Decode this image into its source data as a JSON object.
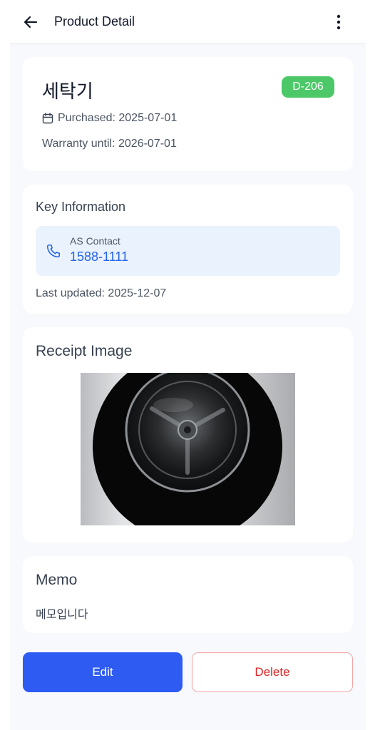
{
  "appbar": {
    "title": "Product Detail",
    "back_icon": "arrow-left-icon",
    "more_icon": "more-vertical-icon"
  },
  "product": {
    "name": "세탁기",
    "badge": "D-206",
    "badge_color": "#4cc869",
    "purchased": "Purchased: 2025-07-01",
    "purchased_icon": "calendar-icon",
    "warranty": "Warranty until: 2026-07-01"
  },
  "key_info": {
    "title": "Key Information",
    "contact_label": "AS Contact",
    "contact_number": "1588-1111",
    "contact_icon": "phone-icon",
    "last_updated": "Last updated: 2025-12-07"
  },
  "receipt": {
    "title": "Receipt Image"
  },
  "memo": {
    "title": "Memo",
    "text": "메모입니다"
  },
  "actions": {
    "edit_label": "Edit",
    "delete_label": "Delete",
    "edit_color": "#2e5bf2",
    "delete_color": "#dc2626"
  }
}
